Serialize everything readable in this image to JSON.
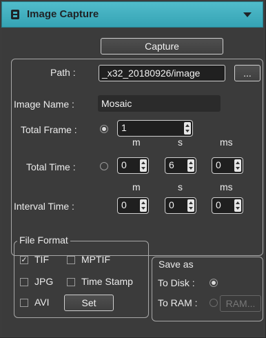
{
  "window": {
    "title": "Image Capture",
    "title_icon": "panel-logo-icon",
    "collapse_icon": "triangle-down-icon"
  },
  "capture": {
    "label": "Capture"
  },
  "path": {
    "label": "Path :",
    "value": "_x32_20180926/image",
    "browse_label": "..."
  },
  "image_name": {
    "label": "Image Name :",
    "value": "Mosaic"
  },
  "total_frame": {
    "label": "Total Frame :",
    "value": "1",
    "selected": true
  },
  "units": {
    "m": "m",
    "s": "s",
    "ms": "ms"
  },
  "total_time": {
    "label": "Total Time :",
    "selected": false,
    "m": "0",
    "s": "6",
    "ms": "0"
  },
  "interval_time": {
    "label": "Interval Time :",
    "m": "0",
    "s": "0",
    "ms": "0"
  },
  "file_format": {
    "legend": "File Format",
    "tif": {
      "label": "TIF",
      "checked": true
    },
    "mptif": {
      "label": "MPTIF",
      "checked": false
    },
    "jpg": {
      "label": "JPG",
      "checked": false
    },
    "time_stamp": {
      "label": "Time Stamp",
      "checked": false
    },
    "avi": {
      "label": "AVI",
      "checked": false
    },
    "set_label": "Set"
  },
  "save_as": {
    "legend": "Save as",
    "to_disk": {
      "label": "To Disk :",
      "selected": true
    },
    "to_ram": {
      "label": "To RAM :",
      "selected": false,
      "button_label": "RAM..."
    }
  },
  "colors": {
    "title_bar": "#44b3c2",
    "panel_bg": "#3b3b3b",
    "text": "#ececec"
  }
}
